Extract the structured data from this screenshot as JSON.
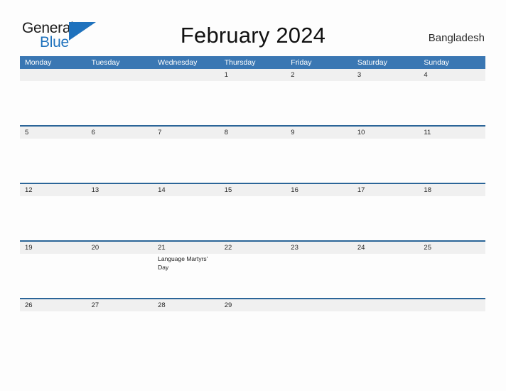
{
  "brand": {
    "word_one": "General",
    "word_two": "Blue",
    "flag_icon": "blue-flag-triangle",
    "flag_color": "#1f72bd"
  },
  "header": {
    "title": "February 2024",
    "country": "Bangladesh"
  },
  "colors": {
    "weekday_header_bg": "#3a77b3",
    "week_divider": "#2b6598",
    "day_band_bg": "#f0f0f0",
    "page_bg": "#fdfdfd",
    "brand_blue": "#1f72bd",
    "text_dark": "#262626"
  },
  "calendar": {
    "month": "February",
    "year": "2024",
    "weekday_headers": [
      "Monday",
      "Tuesday",
      "Wednesday",
      "Thursday",
      "Friday",
      "Saturday",
      "Sunday"
    ],
    "weeks": [
      {
        "days": [
          {
            "number": "",
            "event": ""
          },
          {
            "number": "",
            "event": ""
          },
          {
            "number": "",
            "event": ""
          },
          {
            "number": "1",
            "event": ""
          },
          {
            "number": "2",
            "event": ""
          },
          {
            "number": "3",
            "event": ""
          },
          {
            "number": "4",
            "event": ""
          }
        ]
      },
      {
        "days": [
          {
            "number": "5",
            "event": ""
          },
          {
            "number": "6",
            "event": ""
          },
          {
            "number": "7",
            "event": ""
          },
          {
            "number": "8",
            "event": ""
          },
          {
            "number": "9",
            "event": ""
          },
          {
            "number": "10",
            "event": ""
          },
          {
            "number": "11",
            "event": ""
          }
        ]
      },
      {
        "days": [
          {
            "number": "12",
            "event": ""
          },
          {
            "number": "13",
            "event": ""
          },
          {
            "number": "14",
            "event": ""
          },
          {
            "number": "15",
            "event": ""
          },
          {
            "number": "16",
            "event": ""
          },
          {
            "number": "17",
            "event": ""
          },
          {
            "number": "18",
            "event": ""
          }
        ]
      },
      {
        "days": [
          {
            "number": "19",
            "event": ""
          },
          {
            "number": "20",
            "event": ""
          },
          {
            "number": "21",
            "event": "Language Martyrs' Day"
          },
          {
            "number": "22",
            "event": ""
          },
          {
            "number": "23",
            "event": ""
          },
          {
            "number": "24",
            "event": ""
          },
          {
            "number": "25",
            "event": ""
          }
        ]
      },
      {
        "days": [
          {
            "number": "26",
            "event": ""
          },
          {
            "number": "27",
            "event": ""
          },
          {
            "number": "28",
            "event": ""
          },
          {
            "number": "29",
            "event": ""
          },
          {
            "number": "",
            "event": ""
          },
          {
            "number": "",
            "event": ""
          },
          {
            "number": "",
            "event": ""
          }
        ]
      }
    ]
  }
}
